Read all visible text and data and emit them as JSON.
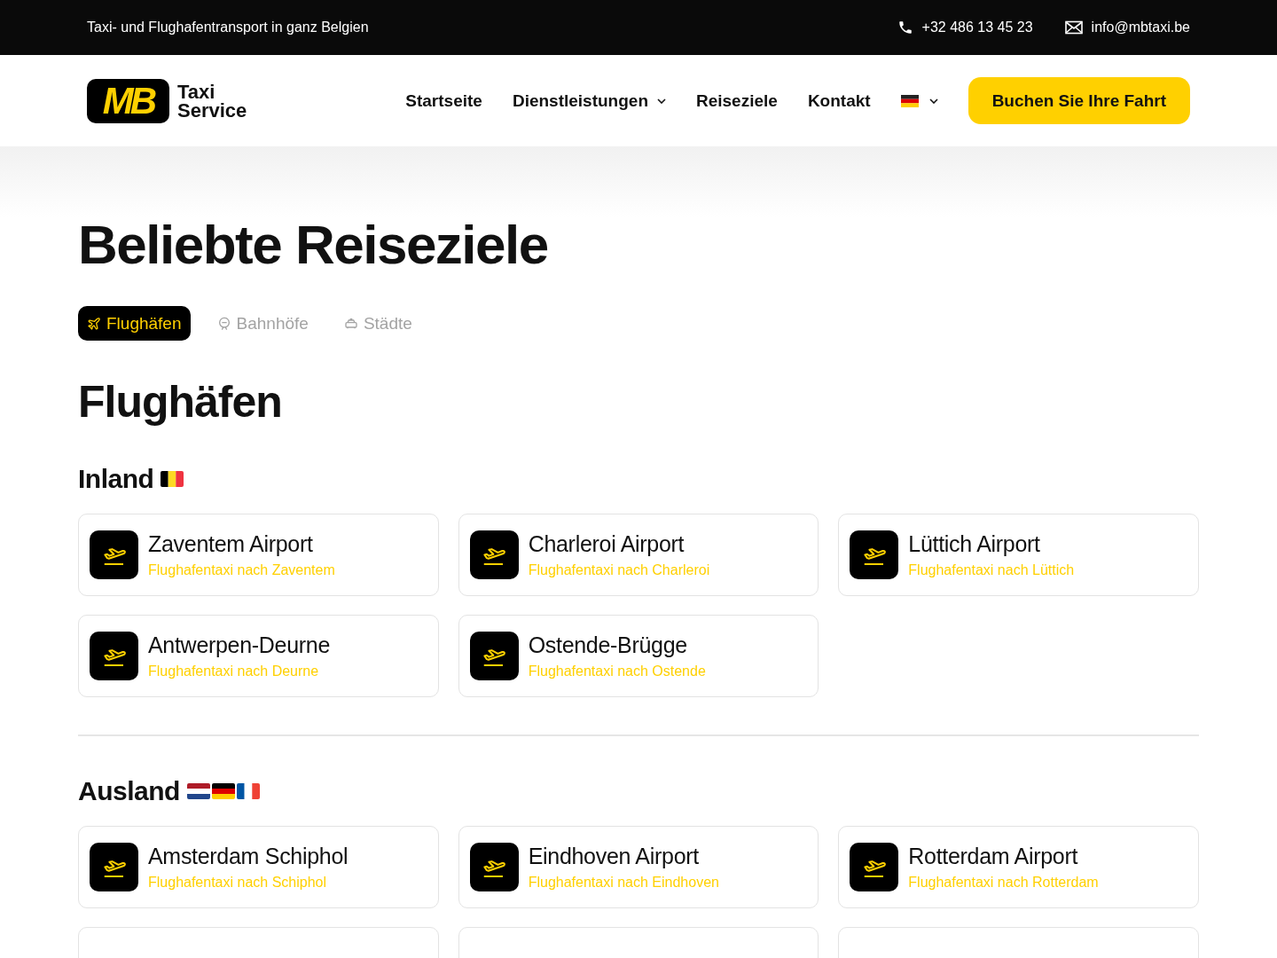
{
  "top_bar": {
    "tagline": "Taxi- und Flughafentransport in ganz Belgien",
    "phone": "+32 486 13 45 23",
    "email": "info@mbtaxi.be"
  },
  "header": {
    "logo": {
      "mark": "MB",
      "line_1": "Taxi",
      "line_2": "Service"
    },
    "nav": [
      {
        "label": "Startseite",
        "dropdown": false
      },
      {
        "label": "Dienstleistungen",
        "dropdown": true
      },
      {
        "label": "Reiseziele",
        "dropdown": false
      },
      {
        "label": "Kontakt",
        "dropdown": false
      }
    ],
    "cta": "Buchen Sie Ihre Fahrt"
  },
  "page_title": "Beliebte Reiseziele",
  "tabs": [
    {
      "label": "Flughäfen",
      "kind": "plane",
      "selected": true
    },
    {
      "label": "Bahnhöfe",
      "kind": "train",
      "selected": false
    },
    {
      "label": "Städte",
      "kind": "car",
      "selected": false
    }
  ],
  "section_title": "Flughäfen",
  "groups": [
    {
      "title": "Inland",
      "kind": "domestic",
      "cards": [
        {
          "title": "Zaventem Airport",
          "subtitle": "Flughafentaxi nach Zaventem"
        },
        {
          "title": "Charleroi Airport",
          "subtitle": "Flughafentaxi nach Charleroi"
        },
        {
          "title": "Lüttich Airport",
          "subtitle": "Flughafentaxi nach Lüttich"
        },
        {
          "title": "Antwerpen-Deurne",
          "subtitle": "Flughafentaxi nach Deurne"
        },
        {
          "title": "Ostende-Brügge",
          "subtitle": "Flughafentaxi nach Ostende"
        }
      ]
    },
    {
      "title": "Ausland",
      "kind": "abroad",
      "cards": [
        {
          "title": "Amsterdam Schiphol",
          "subtitle": "Flughafentaxi nach Schiphol"
        },
        {
          "title": "Eindhoven Airport",
          "subtitle": "Flughafentaxi nach Eindhoven"
        },
        {
          "title": "Rotterdam Airport",
          "subtitle": "Flughafentaxi nach Rotterdam"
        }
      ]
    }
  ]
}
